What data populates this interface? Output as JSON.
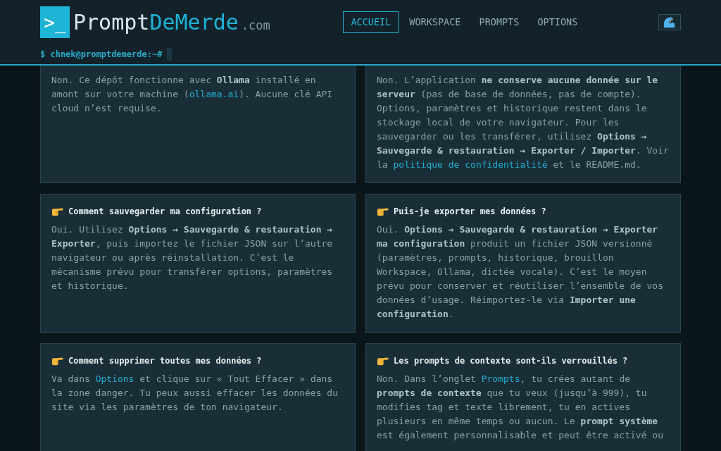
{
  "header": {
    "logo": {
      "mark": ">_",
      "name": "Prompt",
      "name_accent": "DeMerde",
      "domain": ".com"
    },
    "nav": [
      {
        "label": "ACCUEIL",
        "selected": true
      },
      {
        "label": "WORKSPACE",
        "selected": false
      },
      {
        "label": "PROMPTS",
        "selected": false
      },
      {
        "label": "OPTIONS",
        "selected": false
      }
    ],
    "terminal_prompt": "$ chnek@promptdemerde:~#"
  },
  "faq": [
    {
      "answer": [
        {
          "kind": "text",
          "text": "Non. Ce dépôt fonctionne avec **Ollama** installé en amont sur votre machine ("
        },
        {
          "kind": "link",
          "text": "ollama.ai"
        },
        {
          "kind": "text",
          "text": "). Aucune clé API cloud n’est requise."
        }
      ]
    },
    {
      "answer": [
        {
          "kind": "text",
          "text": "Non. L’application **ne conserve aucune donnée sur le serveur** (pas de base de données, pas de compte). Options, paramètres et historique restent dans le stockage local de votre navigateur. Pour les sauvegarder ou les transférer, utilisez **Options → Sauvegarde & restauration → Exporter / Importer**. Voir la "
        },
        {
          "kind": "link",
          "text": "politique de confidentialité"
        },
        {
          "kind": "text",
          "text": " et le README.md."
        }
      ]
    },
    {
      "question": "Comment sauvegarder ma configuration ?",
      "answer": [
        {
          "kind": "text",
          "text": "Oui. Utilisez **Options → Sauvegarde & restauration → Exporter**, puis importez le fichier JSON sur l’autre navigateur ou après réinstallation. C’est le mécanisme prévu pour transférer options, paramètres et historique."
        }
      ]
    },
    {
      "question": "Puis-je exporter mes données ?",
      "answer": [
        {
          "kind": "text",
          "text": "Oui. **Options → Sauvegarde & restauration → Exporter ma configuration** produit un fichier JSON versionné (paramètres, prompts, historique, brouillon Workspace, Ollama, dictée vocale). C’est le moyen prévu pour conserver et réutiliser l’ensemble de vos données d’usage. Réimportez-le via **Importer une configuration**."
        }
      ]
    },
    {
      "question": "Comment supprimer toutes mes données ?",
      "answer": [
        {
          "kind": "text",
          "text": "Va dans "
        },
        {
          "kind": "link",
          "text": "Options"
        },
        {
          "kind": "text",
          "text": " et clique sur « Tout Effacer » dans la zone danger. Tu peux aussi effacer les données du site via les paramètres de ton navigateur."
        }
      ]
    },
    {
      "question": "Les prompts de contexte sont-ils verrouillés ?",
      "answer": [
        {
          "kind": "text",
          "text": "Non. Dans l’onglet "
        },
        {
          "kind": "link",
          "text": "Prompts"
        },
        {
          "kind": "text",
          "text": ", tu crées autant de **prompts de contexte** que tu veux (jusqu’à 999), tu modifies tag et texte librement, tu en actives plusieurs en même temps ou aucun. Le **prompt système** est également personnalisable et peut être activé ou"
        }
      ]
    }
  ]
}
